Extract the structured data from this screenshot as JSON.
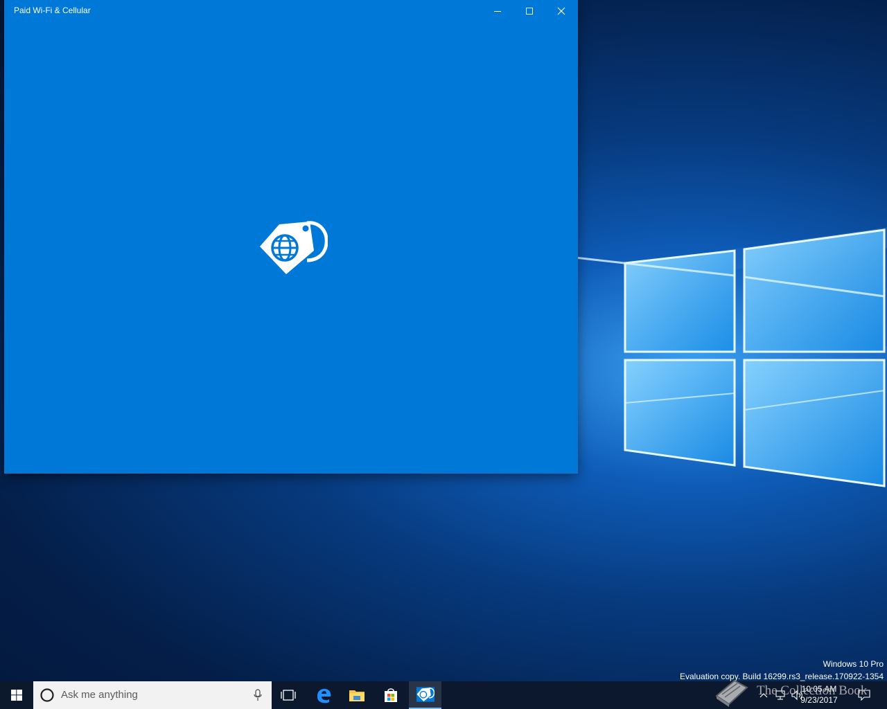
{
  "window": {
    "title": "Paid Wi-Fi & Cellular",
    "controls": {
      "minimize_icon": "minimize-icon",
      "maximize_icon": "maximize-icon",
      "close_icon": "close-icon"
    },
    "background_color": "#0078d7",
    "splash_icon": "sim-tag-globe-icon"
  },
  "watermark": {
    "line1": "Windows 10 Pro",
    "line2": "Evaluation copy. Build 16299.rs3_release.170922-1354"
  },
  "taskbar": {
    "search_placeholder": "Ask me anything",
    "pinned": [
      {
        "name": "task-view",
        "icon": "task-view-icon"
      },
      {
        "name": "edge",
        "icon": "edge-icon"
      },
      {
        "name": "file-explorer",
        "icon": "folder-icon"
      },
      {
        "name": "store",
        "icon": "store-icon"
      },
      {
        "name": "paid-wifi-cellular",
        "icon": "sim-tag-globe-icon",
        "active": true
      }
    ],
    "clock": {
      "time": "10:05 AM",
      "date": "9/23/2017"
    },
    "overlay_text": "The Collection Book"
  }
}
